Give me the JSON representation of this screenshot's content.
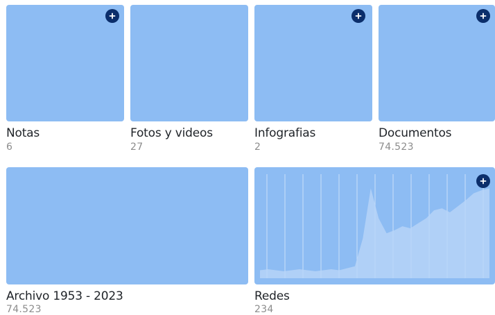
{
  "cards": [
    {
      "key": "notas",
      "label": "Notas",
      "count": "6",
      "has_add": true
    },
    {
      "key": "fotos",
      "label": "Fotos y videos",
      "count": "27",
      "has_add": false
    },
    {
      "key": "infografias",
      "label": "Infografias",
      "count": "2",
      "has_add": true
    },
    {
      "key": "documentos",
      "label": "Documentos",
      "count": "74.523",
      "has_add": true
    },
    {
      "key": "archivo",
      "label": "Archivo 1953 - 2023",
      "count": "74.523",
      "has_add": false
    },
    {
      "key": "redes",
      "label": "Redes",
      "count": "234",
      "has_add": true
    }
  ],
  "icons": {
    "add": "plus-circle-icon"
  },
  "colors": {
    "tile": "#8dbcf3",
    "add_button": "#0b2e6b",
    "label": "#1f2328",
    "count": "#8c8c8c",
    "chart_area": "#b9d5f7"
  },
  "redes_sparkline": {
    "values": [
      0.08,
      0.09,
      0.08,
      0.07,
      0.08,
      0.09,
      0.08,
      0.07,
      0.08,
      0.09,
      0.08,
      0.1,
      0.12,
      0.4,
      0.9,
      0.6,
      0.45,
      0.48,
      0.52,
      0.5,
      0.55,
      0.6,
      0.68,
      0.7,
      0.66,
      0.72,
      0.78,
      0.85,
      0.88,
      0.9
    ]
  }
}
